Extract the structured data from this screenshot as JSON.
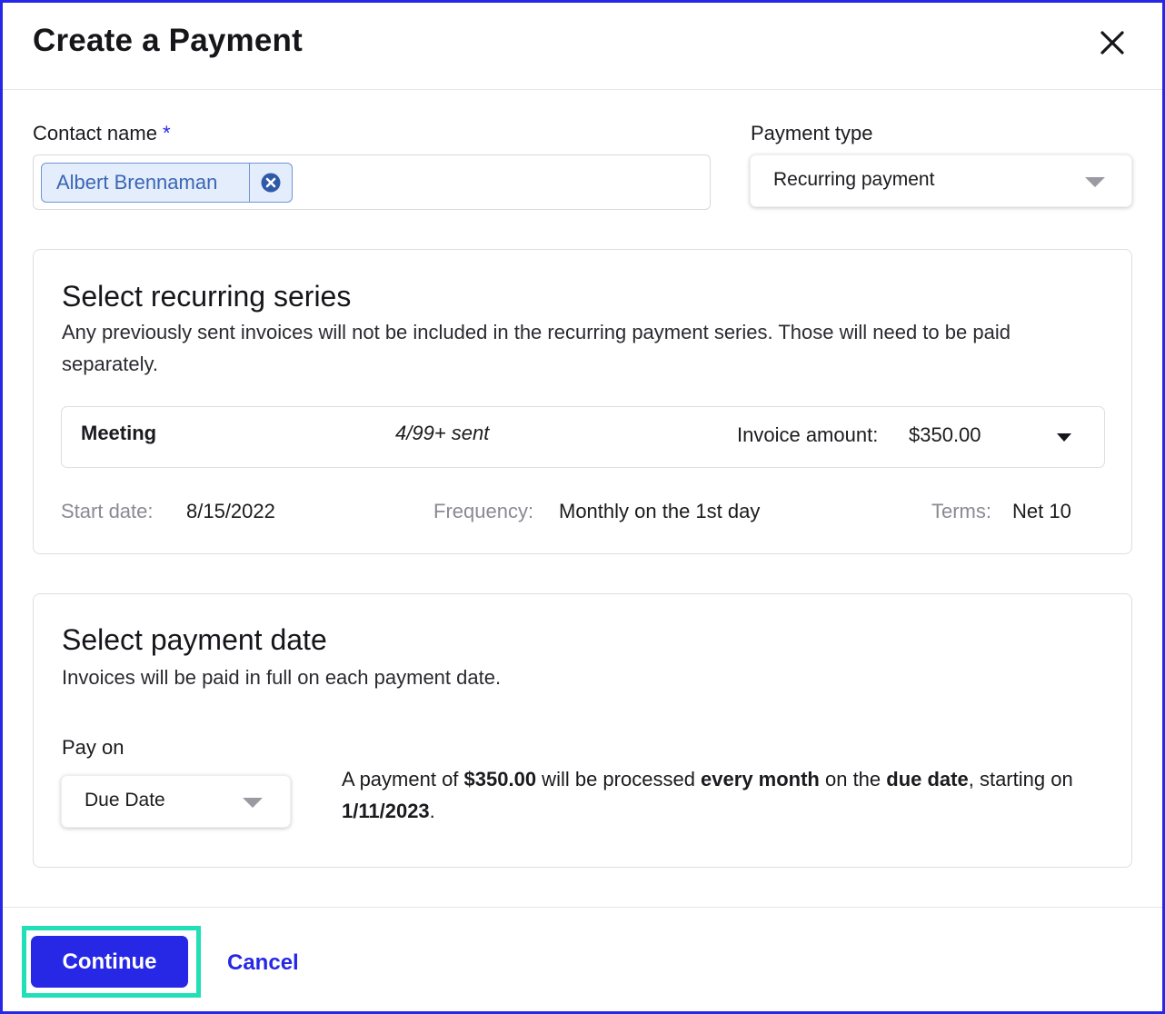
{
  "modal": {
    "title": "Create a Payment"
  },
  "contact": {
    "label": "Contact name",
    "required_mark": "*",
    "selected": "Albert Brennaman"
  },
  "payment_type": {
    "label": "Payment type",
    "value": "Recurring payment"
  },
  "recurring_series": {
    "title": "Select recurring series",
    "description": "Any previously sent invoices will not be included in the recurring payment series. Those will need to be paid separately.",
    "series": {
      "name": "Meeting",
      "sent": "4/99+ sent",
      "amount_label": "Invoice amount:",
      "amount": "$350.00"
    },
    "start_date_label": "Start date:",
    "start_date": "8/15/2022",
    "frequency_label": "Frequency:",
    "frequency": "Monthly on the 1st day",
    "terms_label": "Terms:",
    "terms": "Net 10"
  },
  "payment_date": {
    "title": "Select payment date",
    "description": "Invoices will be paid in full on each payment date.",
    "pay_on_label": "Pay on",
    "pay_on_value": "Due Date",
    "summary": {
      "t1": "A payment of ",
      "amount": "$350.00",
      "t2": " will be processed ",
      "frequency": "every month",
      "t3": " on the ",
      "date_type": "due date",
      "t4": ", starting on ",
      "start": "1/11/2023",
      "t5": "."
    }
  },
  "footer": {
    "continue_label": "Continue",
    "cancel_label": "Cancel"
  },
  "colors": {
    "accent": "#2727e6",
    "focus_ring": "#22dfb8",
    "chip_bg": "#e4edfb",
    "chip_text": "#3a66b6"
  },
  "icons": {
    "close": "close-icon",
    "chip_remove": "remove-circle-icon",
    "dropdown": "chevron-down-icon"
  }
}
